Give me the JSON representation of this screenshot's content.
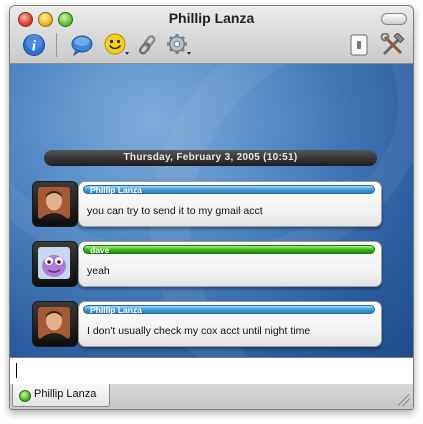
{
  "window": {
    "title": "Phillip Lanza"
  },
  "toolbar": {
    "items": [
      {
        "name": "info",
        "icon": "info-icon"
      },
      {
        "name": "message",
        "icon": "speech-bubble-icon"
      },
      {
        "name": "emoticon",
        "icon": "smiley-icon"
      },
      {
        "name": "link",
        "icon": "link-icon"
      },
      {
        "name": "action",
        "icon": "gear-icon"
      },
      {
        "name": "block",
        "icon": "switch-icon"
      },
      {
        "name": "tools",
        "icon": "tools-icon"
      }
    ]
  },
  "chat": {
    "date_header": "Thursday, February 3, 2005 (10:51)",
    "messages": [
      {
        "sender": "Phillip Lanza",
        "text": "you can try to send it to my gmail acct",
        "color": "#3a9bd6"
      },
      {
        "sender": "dave",
        "text": "yeah",
        "color": "#33b40f"
      },
      {
        "sender": "Phillip Lanza",
        "text": "I don't usually check my cox acct until night time",
        "color": "#3a9bd6"
      }
    ]
  },
  "input": {
    "value": ""
  },
  "tabs": [
    {
      "label": "Phillip Lanza",
      "status": "online",
      "status_color": "#4cbb2a"
    }
  ]
}
